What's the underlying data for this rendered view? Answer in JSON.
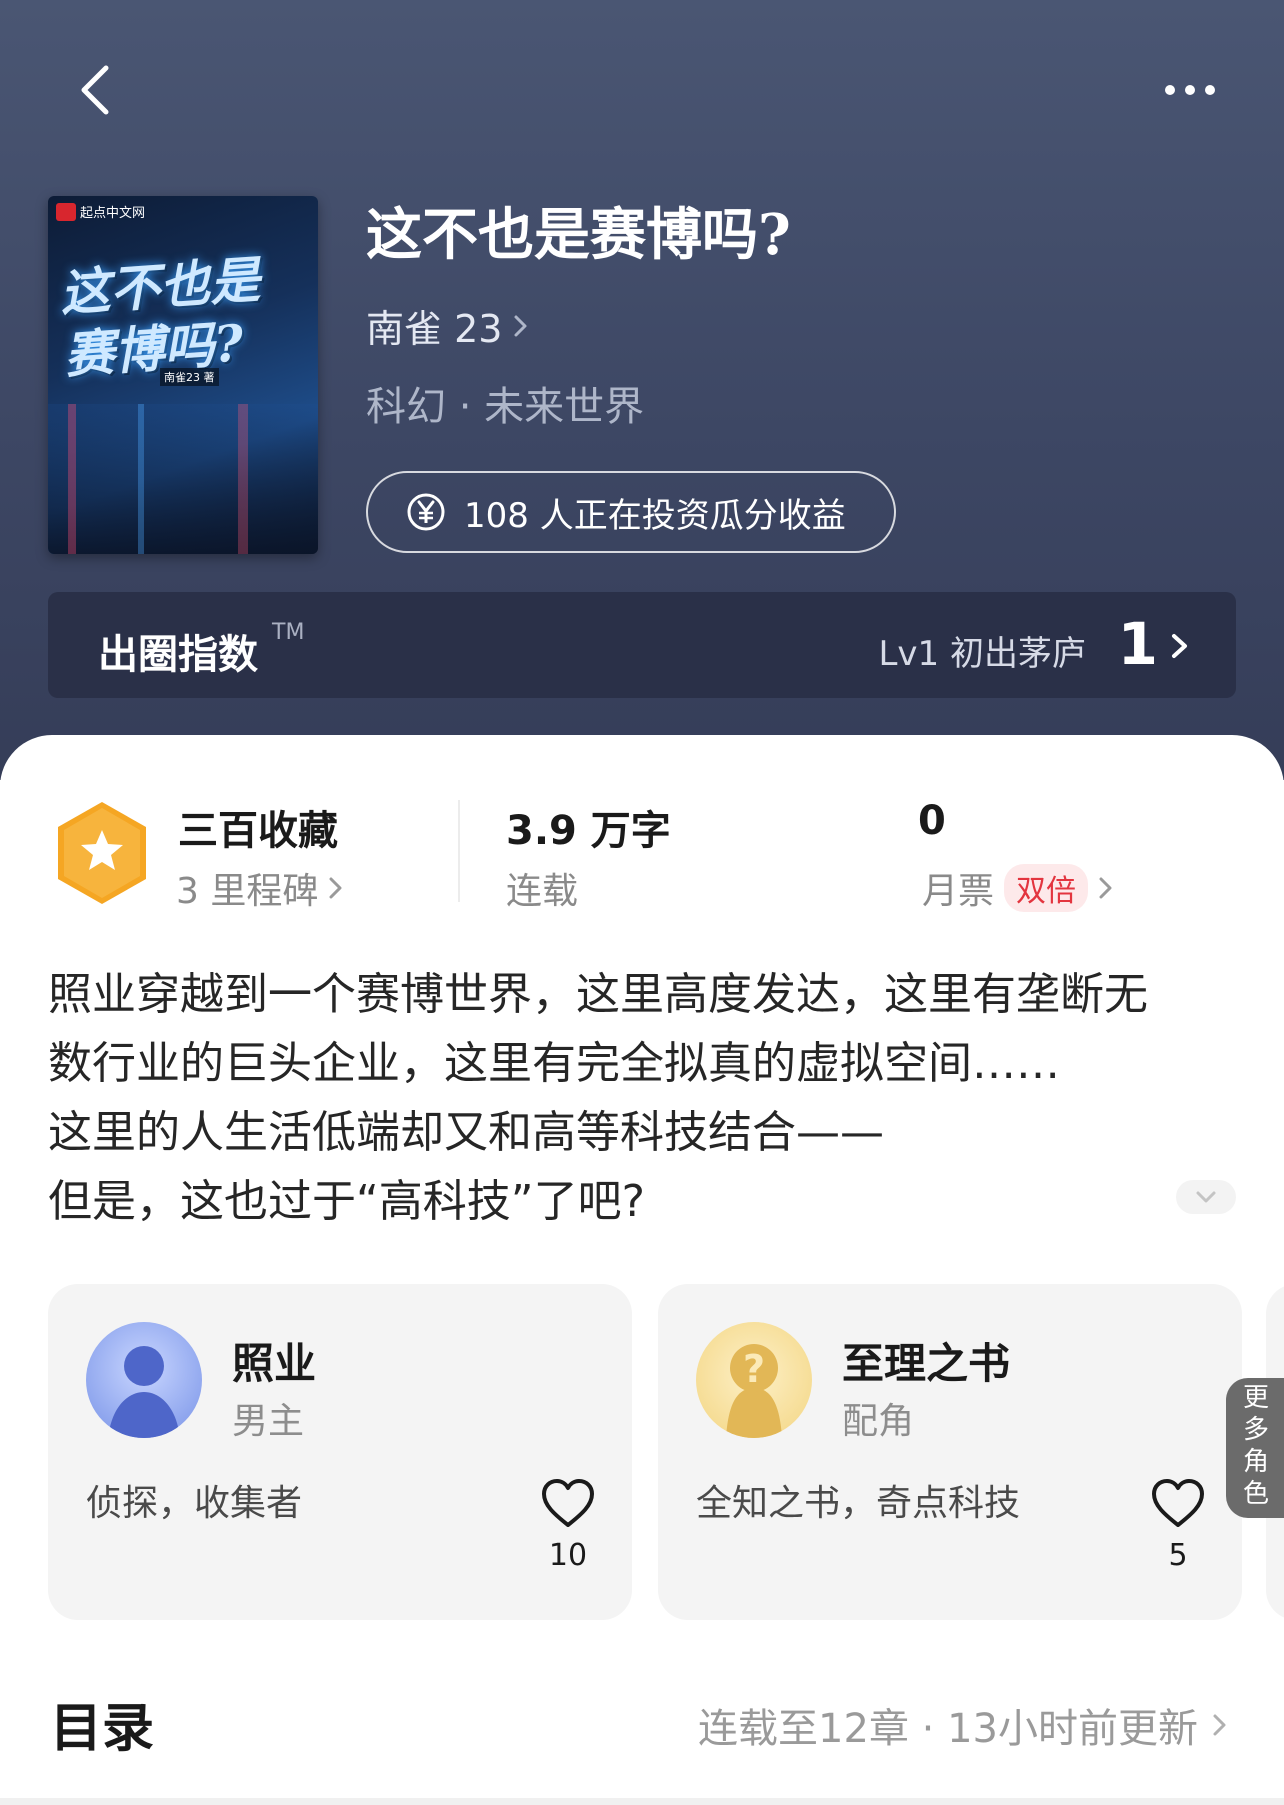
{
  "book": {
    "title": "这不也是赛博吗?",
    "author": "南雀 23",
    "genre": "科幻 · 未来世界",
    "invest_text": "108 人正在投资瓜分收益"
  },
  "cover": {
    "brand": "起点中文网",
    "title_line1": "这不也是",
    "title_line2": "赛博吗?",
    "author": "南雀23 著"
  },
  "index": {
    "label": "出圈指数",
    "tm": "TM",
    "level": "Lv1 初出茅庐",
    "value": "1"
  },
  "stats": {
    "collect_title": "三百收藏",
    "collect_sub": "3 里程碑",
    "words_title": "3.9 万字",
    "words_sub": "连载",
    "tickets_title": "0",
    "tickets_sub": "月票",
    "tickets_tag": "双倍"
  },
  "intro": [
    "照业穿越到一个赛博世界，这里高度发达，这里有垄断无",
    "数行业的巨头企业，这里有完全拟真的虚拟空间……",
    "这里的人生活低端却又和高等科技结合——",
    "但是，这也过于“高科技”了吧?"
  ],
  "characters": [
    {
      "name": "照业",
      "role": "男主",
      "tags": "侦探，收集者",
      "likes": "10"
    },
    {
      "name": "至理之书",
      "role": "配角",
      "tags": "全知之书，奇点科技",
      "likes": "5"
    }
  ],
  "more_roles": [
    "更",
    "多",
    "角",
    "色"
  ],
  "toc": {
    "title": "目录",
    "meta": "连载至12章 · 13小时前更新"
  },
  "colors": {
    "hero_bg": "#3d4764",
    "index_bar_bg": "#2a3048",
    "tag_red": "#e3353f",
    "badge_orange": "#f5a623"
  }
}
